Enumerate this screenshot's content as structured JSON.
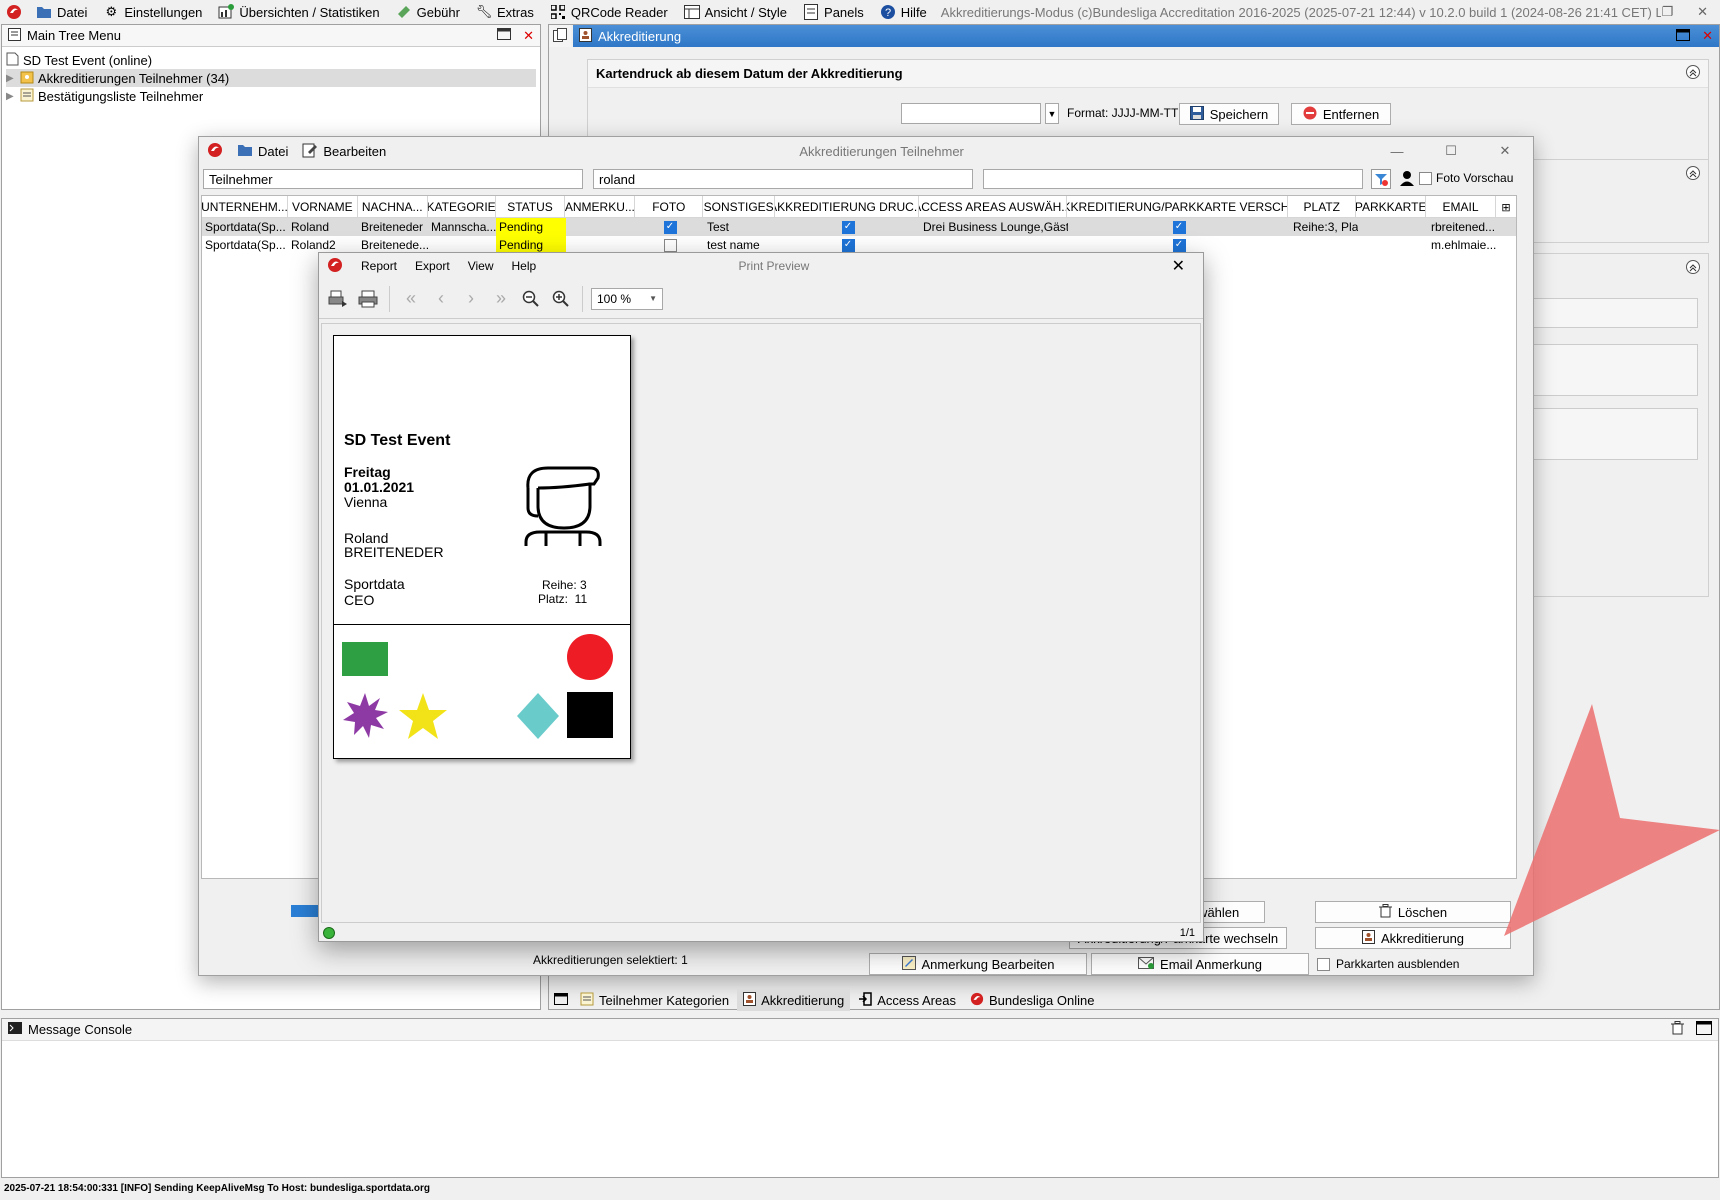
{
  "menubar": {
    "items": [
      {
        "label": "Datei",
        "icon": "folder-icon"
      },
      {
        "label": "Einstellungen",
        "icon": "gear-icon"
      },
      {
        "label": "Übersichten / Statistiken",
        "icon": "chart-icon"
      },
      {
        "label": "Gebühr",
        "icon": "money-icon"
      },
      {
        "label": "Extras",
        "icon": "wrench-icon"
      },
      {
        "label": "QRCode Reader",
        "icon": "qrcode-icon"
      },
      {
        "label": "Ansicht / Style",
        "icon": "grid-icon"
      },
      {
        "label": "Panels",
        "icon": "panel-icon"
      },
      {
        "label": "Hilfe",
        "icon": "help-icon"
      }
    ],
    "app_title": "Akkreditierungs-Modus (c)Bundesliga Accreditation 2016-2025 (2025-07-21 12:44) v 10.2.0 build 1 (2024-08-26 21:41 CET) Lizenz: SDI..."
  },
  "tree": {
    "title": "Main Tree Menu",
    "root": "SD Test Event (online)",
    "items": [
      "Akkreditierungen Teilnehmer (34)",
      "Bestätigungsliste Teilnehmer"
    ]
  },
  "akk": {
    "title": "Akkreditierung",
    "section_title": "Kartendruck ab diesem Datum der Akkreditierung",
    "date_value": "",
    "format_label": "Format: JJJJ-MM-TT",
    "save_label": "Speichern",
    "remove_label": "Entfernen"
  },
  "twin": {
    "title": "Akkreditierungen Teilnehmer",
    "menu": [
      "Datei",
      "Bearbeiten"
    ],
    "filter1": "Teilnehmer",
    "filter2": "roland",
    "filter3": "",
    "photo_preview_label": "Foto Vorschau",
    "columns": [
      "UNTERNEHM...",
      "VORNAME",
      "NACHNA...",
      "KATEGORIE",
      "STATUS",
      "ANMERKU...",
      "FOTO",
      "SONSTIGES",
      "AKKREDITIERUNG DRUC...",
      "ACCESS AREAS AUSWÄH...",
      "AKKREDITIERUNG/PARKKARTE VERSCH...",
      "PLATZ",
      "PARKKARTE",
      "EMAIL"
    ],
    "rows": [
      {
        "unternehmen": "Sportdata(Sp...",
        "vorname": "Roland",
        "nachname": "Breiteneder",
        "kategorie": "Mannscha...",
        "status": "Pending",
        "anmerkung": "",
        "foto": true,
        "sonstiges": "Test",
        "druck": true,
        "access": "Drei Business Lounge,Gäst...",
        "versch": true,
        "platz": "Reihe:3, Pla...",
        "parkkarte": "",
        "email": "rbreitened..."
      },
      {
        "unternehmen": "Sportdata(Sp...",
        "vorname": "Roland2",
        "nachname": "Breitenede...",
        "kategorie": "",
        "status": "Pending",
        "anmerkung": "",
        "foto": false,
        "sonstiges": "test name",
        "druck": true,
        "access": "",
        "versch": true,
        "platz": "",
        "parkkarte": "",
        "email": "m.ehlmaie..."
      }
    ],
    "selected_label": "Akkreditierungen selektiert: 1",
    "buttons": {
      "access_select": "Access Areas auswählen",
      "delete": "Löschen",
      "change": "Akkreditierung/Parkkarte wechseln",
      "accreditation": "Akkreditierung",
      "edit_note": "Anmerkung Bearbeiten",
      "email_note": "Email Anmerkung",
      "hide_parking": "Parkkarten ausblenden"
    }
  },
  "preview": {
    "title": "Print Preview",
    "menu": [
      "Report",
      "Export",
      "View",
      "Help"
    ],
    "zoom": "100 %",
    "page_counter": "1/1",
    "card": {
      "event": "SD Test Event",
      "day": "Freitag",
      "date": "01.01.2021",
      "city": "Vienna",
      "first_name": "Roland",
      "last_name": "BREITENEDER",
      "company": "Sportdata",
      "position": "CEO",
      "row": "Reihe: 3",
      "seat": "Platz:  11",
      "colors": {
        "green": "#2ea043",
        "red": "#ee1c25",
        "purple": "#8e3aa5",
        "yellow": "#f2e318",
        "teal": "#6acbcb",
        "black": "#000000"
      }
    }
  },
  "bottom_tabs": [
    "Teilnehmer Kategorien",
    "Akkreditierung",
    "Access Areas",
    "Bundesliga Online"
  ],
  "console": {
    "title": "Message Console",
    "log": "2025-07-21 18:54:00:331 [INFO] Sending KeepAliveMsg To Host: bundesliga.sportdata.org"
  }
}
